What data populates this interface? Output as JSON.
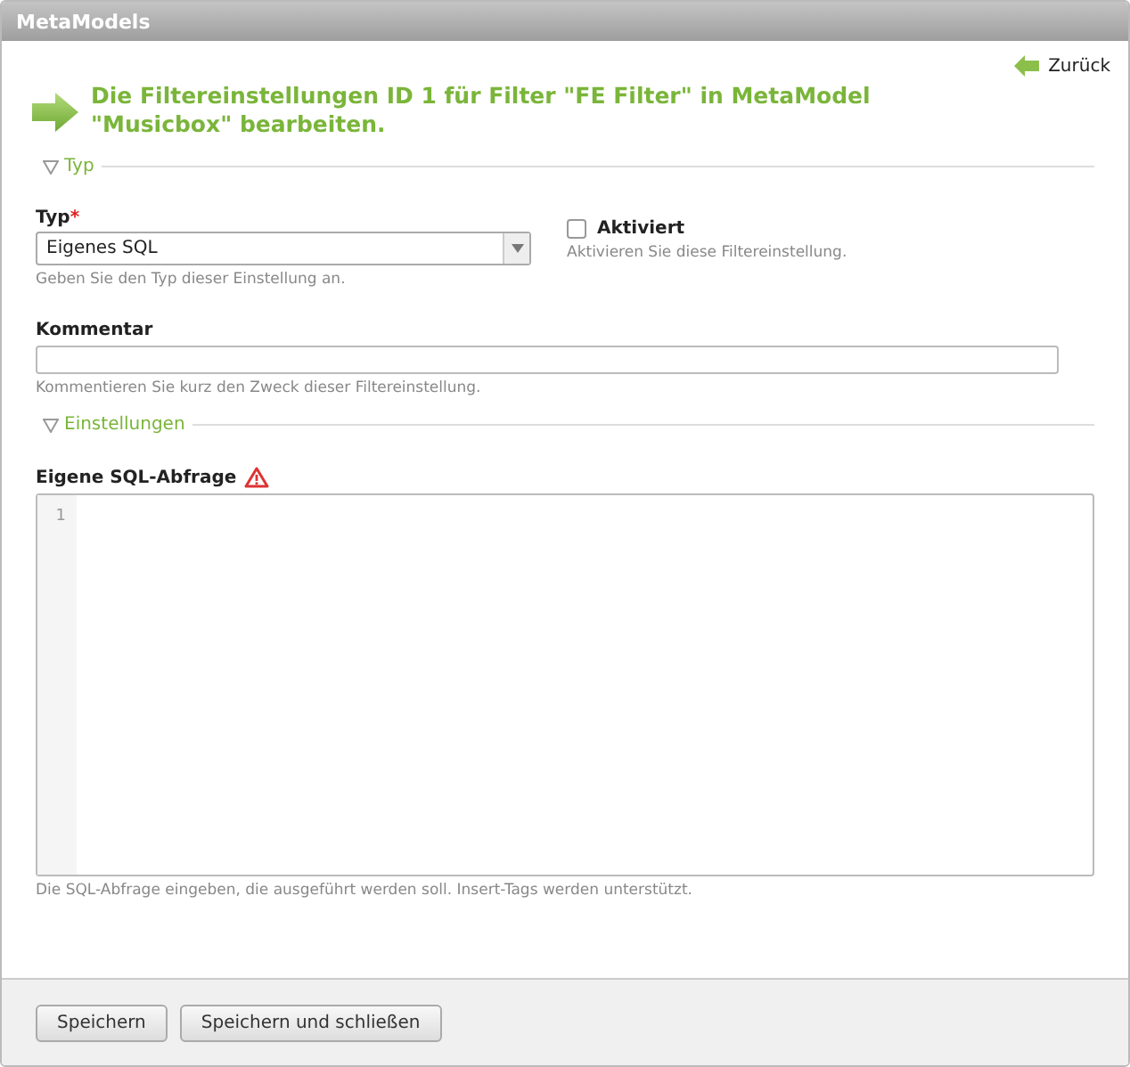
{
  "window": {
    "title": "MetaModels"
  },
  "back_link": "Zurück",
  "heading": "Die Filtereinstellungen ID 1 für Filter \"FE Filter\" in MetaModel \"Musicbox\" bearbeiten.",
  "sections": [
    {
      "legend": "Typ",
      "expanded": true
    },
    {
      "legend": "Einstellungen",
      "expanded": true
    }
  ],
  "type_field": {
    "label": "Typ",
    "required_mark": "*",
    "value": "Eigenes SQL",
    "help": "Geben Sie den Typ dieser Einstellung an."
  },
  "active_field": {
    "label": "Aktiviert",
    "checked": false,
    "help": "Aktivieren Sie diese Filtereinstellung."
  },
  "comment_field": {
    "label": "Kommentar",
    "help": "Kommentieren Sie kurz den Zweck dieser Filtereinstellung."
  },
  "sql_field": {
    "label": "Eigene SQL-Abfrage",
    "line_numbers": [
      "1"
    ],
    "help": "Die SQL-Abfrage eingeben, die ausgeführt werden soll. Insert-Tags werden unterstützt."
  },
  "buttons": [
    "Speichern",
    "Speichern und schließen"
  ]
}
